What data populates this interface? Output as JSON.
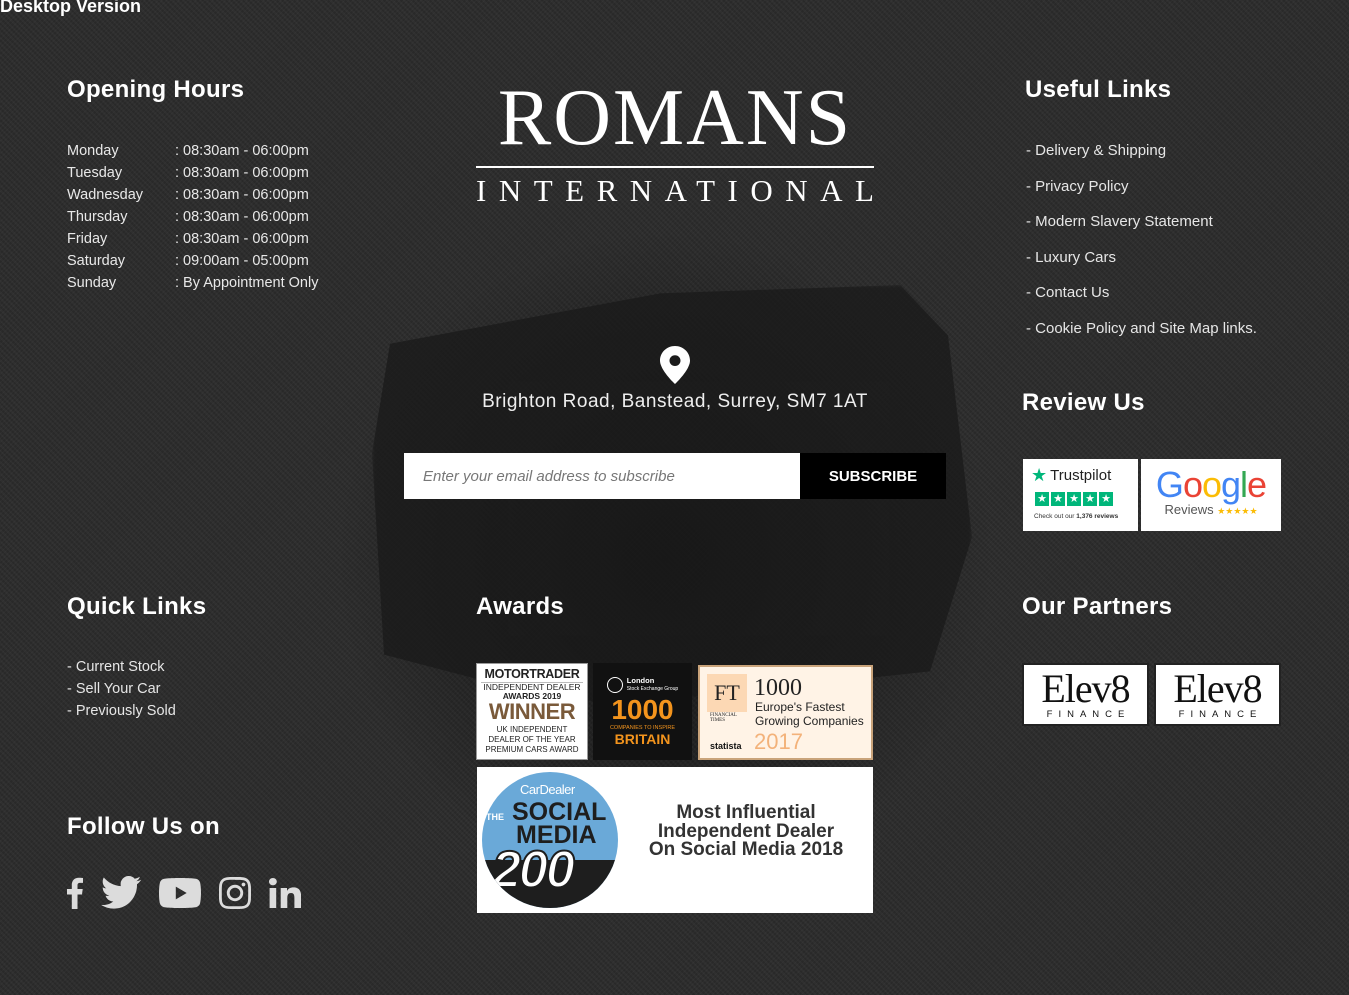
{
  "site": {
    "desktop_label": "Desktop Version"
  },
  "opening_hours": {
    "title": "Opening Hours",
    "rows": [
      {
        "day": "Monday",
        "time": ": 08:30am - 06:00pm"
      },
      {
        "day": "Tuesday",
        "time": ": 08:30am - 06:00pm"
      },
      {
        "day": "Wadnesday",
        "time": ": 08:30am - 06:00pm"
      },
      {
        "day": "Thursday",
        "time": ": 08:30am - 06:00pm"
      },
      {
        "day": "Friday",
        "time": ": 08:30am - 06:00pm"
      },
      {
        "day": "Saturday",
        "time": ": 09:00am - 05:00pm"
      },
      {
        "day": "Sunday",
        "time": ": By Appointment Only"
      }
    ]
  },
  "logo": {
    "main": "ROMANS",
    "sub": "INTERNATIONAL"
  },
  "useful_links": {
    "title": "Useful Links",
    "items": [
      "- Delivery & Shipping",
      "- Privacy Policy",
      "- Modern Slavery Statement",
      "- Luxury Cars",
      "- Contact Us",
      "- Cookie Policy and Site Map links."
    ]
  },
  "address": {
    "icon": "map-pin-icon",
    "text": "Brighton Road, Banstead, Surrey, SM7 1AT"
  },
  "subscribe": {
    "placeholder": "Enter your email address to subscribe",
    "button": "SUBSCRIBE"
  },
  "review_us": {
    "title": "Review Us",
    "trustpilot": {
      "name": "Trustpilot",
      "note_prefix": "Check out our",
      "note_count": "1,376 reviews",
      "color": "#00b67a"
    },
    "google": {
      "name": "Google",
      "sub": "Reviews",
      "stars": "★★★★★"
    }
  },
  "quick_links": {
    "title": "Quick Links",
    "items": [
      "- Current Stock",
      "- Sell Your Car",
      "- Previously Sold"
    ]
  },
  "follow": {
    "title": "Follow Us on",
    "icons": [
      "facebook-icon",
      "twitter-icon",
      "youtube-icon",
      "instagram-icon",
      "linkedin-icon"
    ]
  },
  "awards": {
    "title": "Awards",
    "motortrader": {
      "brand": "MOTORTRADER",
      "line1": "INDEPENDENT DEALER",
      "line2": "AWARDS 2019",
      "winner": "WINNER",
      "l3": "UK INDEPENDENT",
      "l4": "DEALER OF THE YEAR",
      "l5": "PREMIUM CARS AWARD"
    },
    "lse": {
      "top1": "London",
      "top2": "Stock Exchange Group",
      "num": "1000",
      "small": "COMPANIES TO INSPIRE",
      "country": "BRITAIN"
    },
    "ft": {
      "ft": "FT",
      "num": "1000",
      "l1": "Europe's Fastest",
      "l2": "Growing Companies",
      "ft_small": "FINANCIAL TIMES",
      "statista": "statista",
      "year": "2017"
    },
    "social": {
      "brand": "CarDealer",
      "the": "THE",
      "w1": "SOCIAL",
      "w2": "MEDIA",
      "num": "200",
      "l1": "Most Influential",
      "l2": "Independent Dealer",
      "l3": "On Social Media 2018"
    }
  },
  "partners": {
    "title": "Our Partners",
    "items": [
      {
        "name": "Elev8",
        "sub": "FINANCE"
      },
      {
        "name": "Elev8",
        "sub": "FINANCE"
      }
    ]
  }
}
